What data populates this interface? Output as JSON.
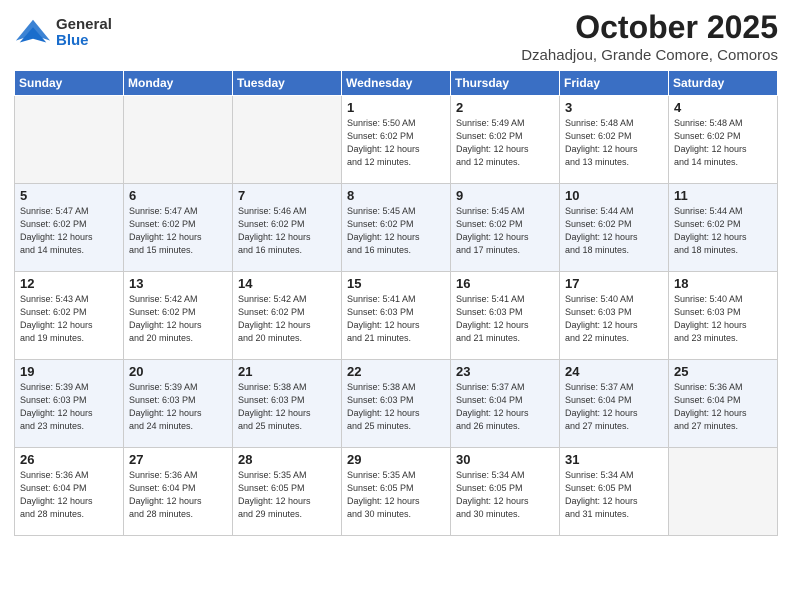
{
  "header": {
    "logo_general": "General",
    "logo_blue": "Blue",
    "month": "October 2025",
    "location": "Dzahadjou, Grande Comore, Comoros"
  },
  "weekdays": [
    "Sunday",
    "Monday",
    "Tuesday",
    "Wednesday",
    "Thursday",
    "Friday",
    "Saturday"
  ],
  "weeks": [
    [
      {
        "day": "",
        "info": ""
      },
      {
        "day": "",
        "info": ""
      },
      {
        "day": "",
        "info": ""
      },
      {
        "day": "1",
        "info": "Sunrise: 5:50 AM\nSunset: 6:02 PM\nDaylight: 12 hours\nand 12 minutes."
      },
      {
        "day": "2",
        "info": "Sunrise: 5:49 AM\nSunset: 6:02 PM\nDaylight: 12 hours\nand 12 minutes."
      },
      {
        "day": "3",
        "info": "Sunrise: 5:48 AM\nSunset: 6:02 PM\nDaylight: 12 hours\nand 13 minutes."
      },
      {
        "day": "4",
        "info": "Sunrise: 5:48 AM\nSunset: 6:02 PM\nDaylight: 12 hours\nand 14 minutes."
      }
    ],
    [
      {
        "day": "5",
        "info": "Sunrise: 5:47 AM\nSunset: 6:02 PM\nDaylight: 12 hours\nand 14 minutes."
      },
      {
        "day": "6",
        "info": "Sunrise: 5:47 AM\nSunset: 6:02 PM\nDaylight: 12 hours\nand 15 minutes."
      },
      {
        "day": "7",
        "info": "Sunrise: 5:46 AM\nSunset: 6:02 PM\nDaylight: 12 hours\nand 16 minutes."
      },
      {
        "day": "8",
        "info": "Sunrise: 5:45 AM\nSunset: 6:02 PM\nDaylight: 12 hours\nand 16 minutes."
      },
      {
        "day": "9",
        "info": "Sunrise: 5:45 AM\nSunset: 6:02 PM\nDaylight: 12 hours\nand 17 minutes."
      },
      {
        "day": "10",
        "info": "Sunrise: 5:44 AM\nSunset: 6:02 PM\nDaylight: 12 hours\nand 18 minutes."
      },
      {
        "day": "11",
        "info": "Sunrise: 5:44 AM\nSunset: 6:02 PM\nDaylight: 12 hours\nand 18 minutes."
      }
    ],
    [
      {
        "day": "12",
        "info": "Sunrise: 5:43 AM\nSunset: 6:02 PM\nDaylight: 12 hours\nand 19 minutes."
      },
      {
        "day": "13",
        "info": "Sunrise: 5:42 AM\nSunset: 6:02 PM\nDaylight: 12 hours\nand 20 minutes."
      },
      {
        "day": "14",
        "info": "Sunrise: 5:42 AM\nSunset: 6:02 PM\nDaylight: 12 hours\nand 20 minutes."
      },
      {
        "day": "15",
        "info": "Sunrise: 5:41 AM\nSunset: 6:03 PM\nDaylight: 12 hours\nand 21 minutes."
      },
      {
        "day": "16",
        "info": "Sunrise: 5:41 AM\nSunset: 6:03 PM\nDaylight: 12 hours\nand 21 minutes."
      },
      {
        "day": "17",
        "info": "Sunrise: 5:40 AM\nSunset: 6:03 PM\nDaylight: 12 hours\nand 22 minutes."
      },
      {
        "day": "18",
        "info": "Sunrise: 5:40 AM\nSunset: 6:03 PM\nDaylight: 12 hours\nand 23 minutes."
      }
    ],
    [
      {
        "day": "19",
        "info": "Sunrise: 5:39 AM\nSunset: 6:03 PM\nDaylight: 12 hours\nand 23 minutes."
      },
      {
        "day": "20",
        "info": "Sunrise: 5:39 AM\nSunset: 6:03 PM\nDaylight: 12 hours\nand 24 minutes."
      },
      {
        "day": "21",
        "info": "Sunrise: 5:38 AM\nSunset: 6:03 PM\nDaylight: 12 hours\nand 25 minutes."
      },
      {
        "day": "22",
        "info": "Sunrise: 5:38 AM\nSunset: 6:03 PM\nDaylight: 12 hours\nand 25 minutes."
      },
      {
        "day": "23",
        "info": "Sunrise: 5:37 AM\nSunset: 6:04 PM\nDaylight: 12 hours\nand 26 minutes."
      },
      {
        "day": "24",
        "info": "Sunrise: 5:37 AM\nSunset: 6:04 PM\nDaylight: 12 hours\nand 27 minutes."
      },
      {
        "day": "25",
        "info": "Sunrise: 5:36 AM\nSunset: 6:04 PM\nDaylight: 12 hours\nand 27 minutes."
      }
    ],
    [
      {
        "day": "26",
        "info": "Sunrise: 5:36 AM\nSunset: 6:04 PM\nDaylight: 12 hours\nand 28 minutes."
      },
      {
        "day": "27",
        "info": "Sunrise: 5:36 AM\nSunset: 6:04 PM\nDaylight: 12 hours\nand 28 minutes."
      },
      {
        "day": "28",
        "info": "Sunrise: 5:35 AM\nSunset: 6:05 PM\nDaylight: 12 hours\nand 29 minutes."
      },
      {
        "day": "29",
        "info": "Sunrise: 5:35 AM\nSunset: 6:05 PM\nDaylight: 12 hours\nand 30 minutes."
      },
      {
        "day": "30",
        "info": "Sunrise: 5:34 AM\nSunset: 6:05 PM\nDaylight: 12 hours\nand 30 minutes."
      },
      {
        "day": "31",
        "info": "Sunrise: 5:34 AM\nSunset: 6:05 PM\nDaylight: 12 hours\nand 31 minutes."
      },
      {
        "day": "",
        "info": ""
      }
    ]
  ]
}
